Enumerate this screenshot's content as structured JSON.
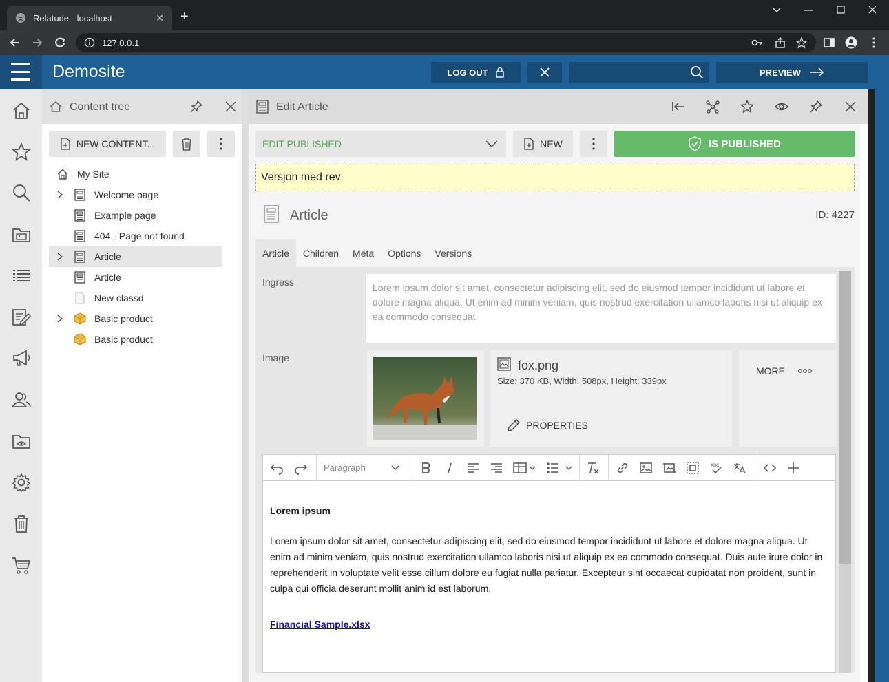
{
  "browser": {
    "tab_title": "Relatude - localhost",
    "url": "127.0.0.1"
  },
  "header": {
    "site_name": "Demosite",
    "logout_label": "LOG OUT",
    "preview_label": "PREVIEW"
  },
  "tree": {
    "title": "Content tree",
    "new_content_label": "NEW CONTENT...",
    "items": [
      {
        "label": "My Site",
        "icon": "home-icon",
        "expandable": false
      },
      {
        "label": "Welcome page",
        "icon": "page-icon",
        "expandable": true
      },
      {
        "label": "Example page",
        "icon": "page-icon",
        "expandable": false
      },
      {
        "label": "404 - Page not found",
        "icon": "page-icon",
        "expandable": false
      },
      {
        "label": "Article",
        "icon": "page-icon",
        "expandable": true,
        "selected": true
      },
      {
        "label": "Article",
        "icon": "page-icon",
        "expandable": false
      },
      {
        "label": "New classd",
        "icon": "blank-doc-icon",
        "expandable": false
      },
      {
        "label": "Basic product",
        "icon": "box-icon",
        "expandable": true
      },
      {
        "label": "Basic product",
        "icon": "box-icon",
        "expandable": false
      }
    ]
  },
  "editor": {
    "title": "Edit Article",
    "state_label": "EDIT PUBLISHED",
    "new_label": "NEW",
    "published_label": "IS PUBLISHED",
    "version_note": "Versjon med rev",
    "doc_type": "Article",
    "doc_id": "ID: 4227",
    "tabs": [
      "Article",
      "Children",
      "Meta",
      "Options",
      "Versions"
    ],
    "ingress_label": "Ingress",
    "ingress_text": "Lorem ipsum dolor sit amet, consectetur adipiscing elit, sed do eiusmod tempor incididunt ut labore et dolore magna aliqua. Ut enim ad minim veniam, quis nostrud exercitation ullamco laboris nisi ut aliquip ex ea commodo consequat",
    "image_label": "Image",
    "image_name": "fox.png",
    "image_meta": "Size: 370 KB, Width: 508px, Height: 339px",
    "properties_label": "PROPERTIES",
    "more_label": "MORE",
    "format_select": "Paragraph",
    "body_heading": "Lorem ipsum",
    "body_text": "Lorem ipsum dolor sit amet, consectetur adipiscing elit, sed do eiusmod tempor incididunt ut labore et dolore magna aliqua. Ut enim ad minim veniam, quis nostrud exercitation ullamco laboris nisi ut aliquip ex ea commodo consequat. Duis aute irure dolor in reprehenderit in voluptate velit esse cillum dolore eu fugiat nulla pariatur. Excepteur sint occaecat cupidatat non proident, sunt in culpa qui officia deserunt mollit anim id est laborum.",
    "body_link": "Financial Sample.xlsx"
  },
  "colors": {
    "header_blue": "#1f6096",
    "published_green": "#66bb6a",
    "version_note_bg": "#ffffcc"
  }
}
